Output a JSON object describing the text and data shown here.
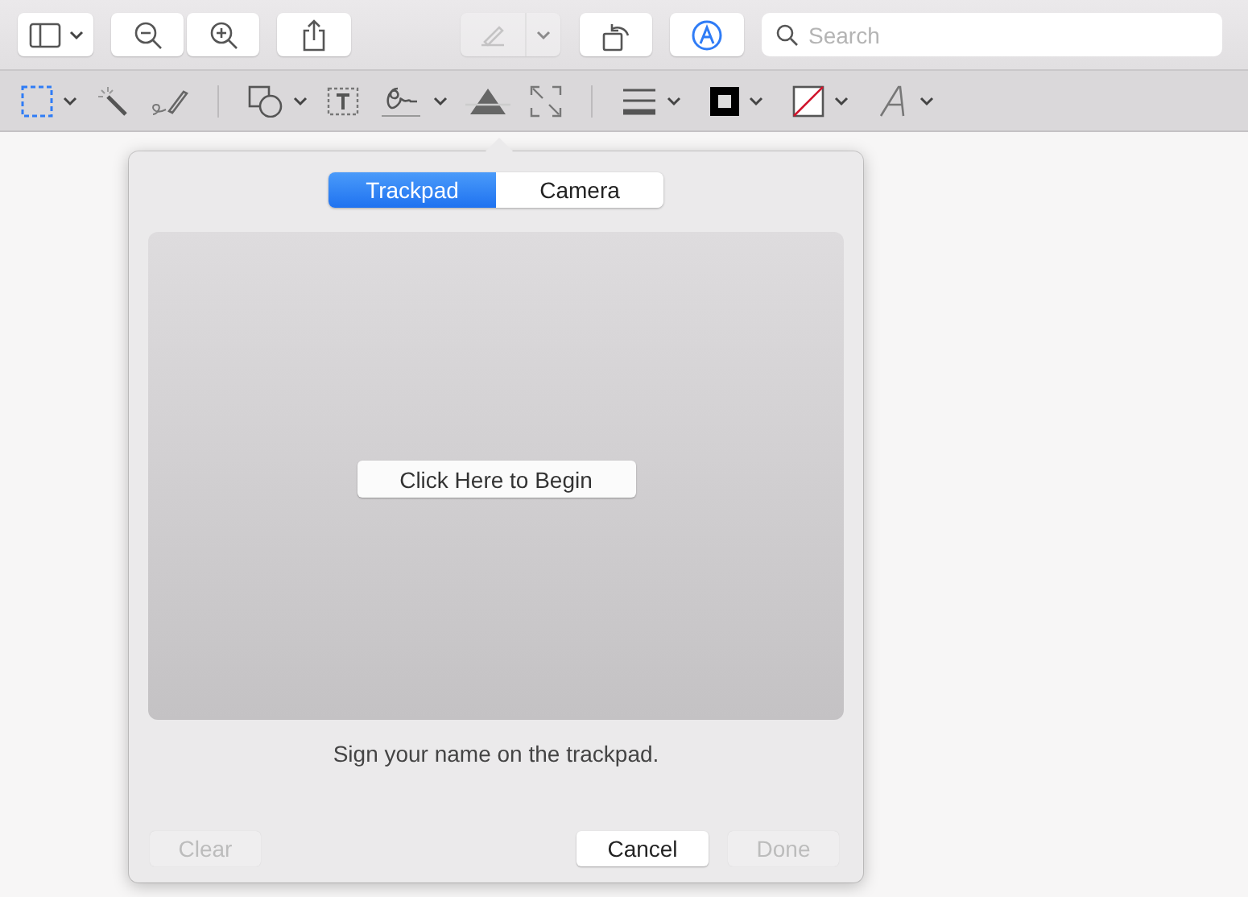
{
  "toolbar": {
    "highlight_tool": {
      "disabled": true
    },
    "search": {
      "placeholder": "Search"
    }
  },
  "popover": {
    "tabs": [
      {
        "label": "Trackpad",
        "selected": true
      },
      {
        "label": "Camera",
        "selected": false
      }
    ],
    "start_button": "Click Here to Begin",
    "instruction": "Sign your name on the trackpad.",
    "buttons": [
      {
        "label": "Clear",
        "disabled": true
      },
      {
        "label": "Cancel",
        "disabled": false
      },
      {
        "label": "Done",
        "disabled": true
      }
    ]
  }
}
